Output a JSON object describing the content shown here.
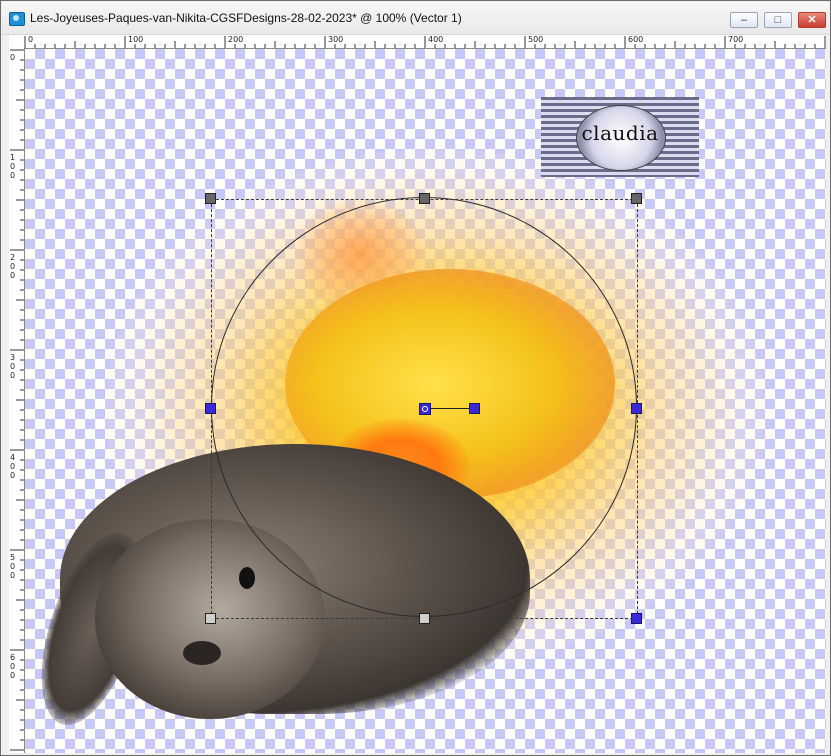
{
  "window": {
    "title": "Les-Joyeuses-Paques-van-Nikita-CGSFDesigns-28-02-2023* @ 100% (Vector 1)",
    "controls": {
      "minimize": "–",
      "maximize": "□",
      "close": "✕"
    }
  },
  "ruler": {
    "horizontal_labels": [
      "0",
      "100",
      "200",
      "300",
      "400",
      "500",
      "600",
      "700"
    ],
    "vertical_labels": [
      "0",
      "100",
      "200",
      "300",
      "400",
      "500",
      "600"
    ]
  },
  "watermark": {
    "text": "claudia"
  },
  "icons": {
    "app": "app-icon",
    "minimize": "minimize-icon",
    "maximize": "maximize-icon",
    "close": "close-icon"
  },
  "colors": {
    "checker": "#c8c8f8",
    "selection_handle": "#3a2ad6",
    "close_button": "#c73d2f"
  }
}
